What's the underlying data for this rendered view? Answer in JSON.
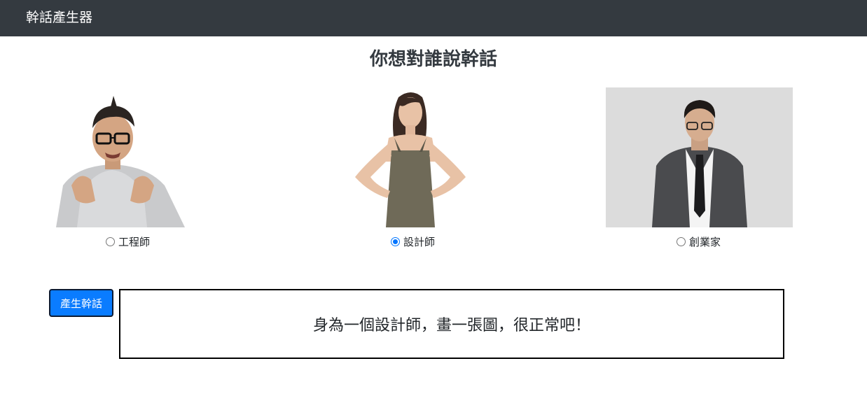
{
  "navbar": {
    "brand": "幹話產生器"
  },
  "page": {
    "title": "你想對誰說幹話"
  },
  "options": [
    {
      "id": "engineer",
      "label": "工程師",
      "checked": false
    },
    {
      "id": "designer",
      "label": "設計師",
      "checked": true
    },
    {
      "id": "entrepreneur",
      "label": "創業家",
      "checked": false
    }
  ],
  "actions": {
    "generate_label": "產生幹話"
  },
  "result": {
    "text": "身為一個設計師，畫一張圖，很正常吧！"
  },
  "colors": {
    "navbar_bg": "#343a40",
    "button_bg": "#0a7cff",
    "radio_accent": "#0075ff"
  },
  "icons": {
    "radio_unchecked": "radio-empty-icon",
    "radio_checked": "radio-filled-icon"
  }
}
